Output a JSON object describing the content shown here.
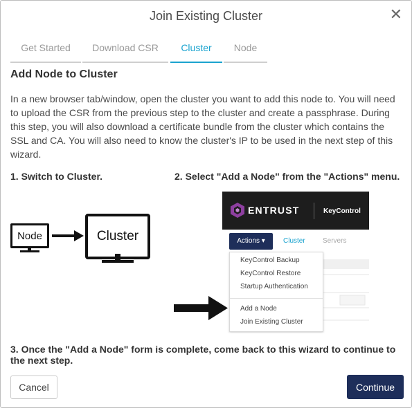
{
  "dialog": {
    "title": "Join Existing Cluster",
    "close_icon": "close-icon"
  },
  "tabs": [
    {
      "label": "Get Started"
    },
    {
      "label": "Download CSR"
    },
    {
      "label": "Cluster"
    },
    {
      "label": "Node"
    }
  ],
  "active_tab": "Cluster",
  "content": {
    "heading": "Add Node to Cluster",
    "paragraph": "In a new browser tab/window, open the cluster you want to add this node to. You will need to upload the CSR from the previous step to the cluster and create a passphrase. During this step, you will also download a certificate bundle from the cluster which contains the SSL and CA. You will also need to know the cluster's IP to be used in the next step of this wizard.",
    "step1": "1. Switch to Cluster.",
    "step2": "2. Select \"Add a Node\" from the \"Actions\" menu.",
    "step3": "3. Once the \"Add a Node\" form is complete, come back to this wizard to continue to the next step.",
    "illustration": {
      "node_label": "Node",
      "cluster_label": "Cluster"
    },
    "screenshot": {
      "brand": "ENTRUST",
      "product": "KeyControl",
      "actions_label": "Actions ▾",
      "nav_cluster": "Cluster",
      "nav_servers": "Servers",
      "menu_items": [
        "KeyControl Backup",
        "KeyControl Restore",
        "Startup Authentication",
        "Add a Node",
        "Join Existing Cluster"
      ]
    }
  },
  "footer": {
    "cancel_label": "Cancel",
    "continue_label": "Continue"
  },
  "colors": {
    "accent": "#1aa3cf",
    "primary_button": "#1e2e5a",
    "brand_header": "#1d1d1d",
    "brand_logo": "#8e3fa0"
  }
}
